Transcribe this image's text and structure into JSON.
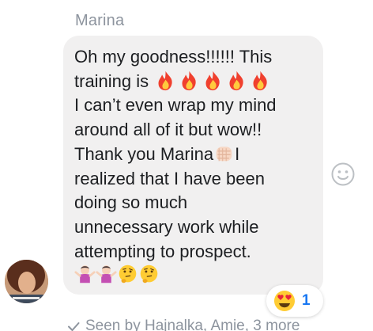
{
  "conversation": {
    "sender_name": "Marina",
    "message": {
      "line1": "Oh my goodness!!!!!! This",
      "line2_text": "training is",
      "line2_icons": [
        "fire-icon",
        "fire-icon",
        "fire-icon",
        "fire-icon",
        "fire-icon"
      ],
      "line3": "I can’t even wrap my mind",
      "line4": "around all of it but wow!!",
      "line5_text": "Thank you Marina",
      "line5_icon": "fist-emoji-icon",
      "line5_tail": "I",
      "line6": "realized that I have been",
      "line7": "doing so much",
      "line8": "unnecessary work while",
      "line9": "attempting to prospect.",
      "line10_icons": [
        "woman-shrugging-icon",
        "woman-shrugging-icon",
        "thinking-face-icon",
        "thinking-face-icon"
      ]
    },
    "reaction": {
      "icon": "heart-eyes-icon",
      "count": "1"
    },
    "react_button_icon": "smiley-icon",
    "seen_text": "Seen by Hajnalka, Amie, 3 more",
    "colors": {
      "bubble": "#f1f0f0",
      "text": "#1c1e21",
      "meta": "#8d949e",
      "accent": "#1877f2"
    }
  }
}
